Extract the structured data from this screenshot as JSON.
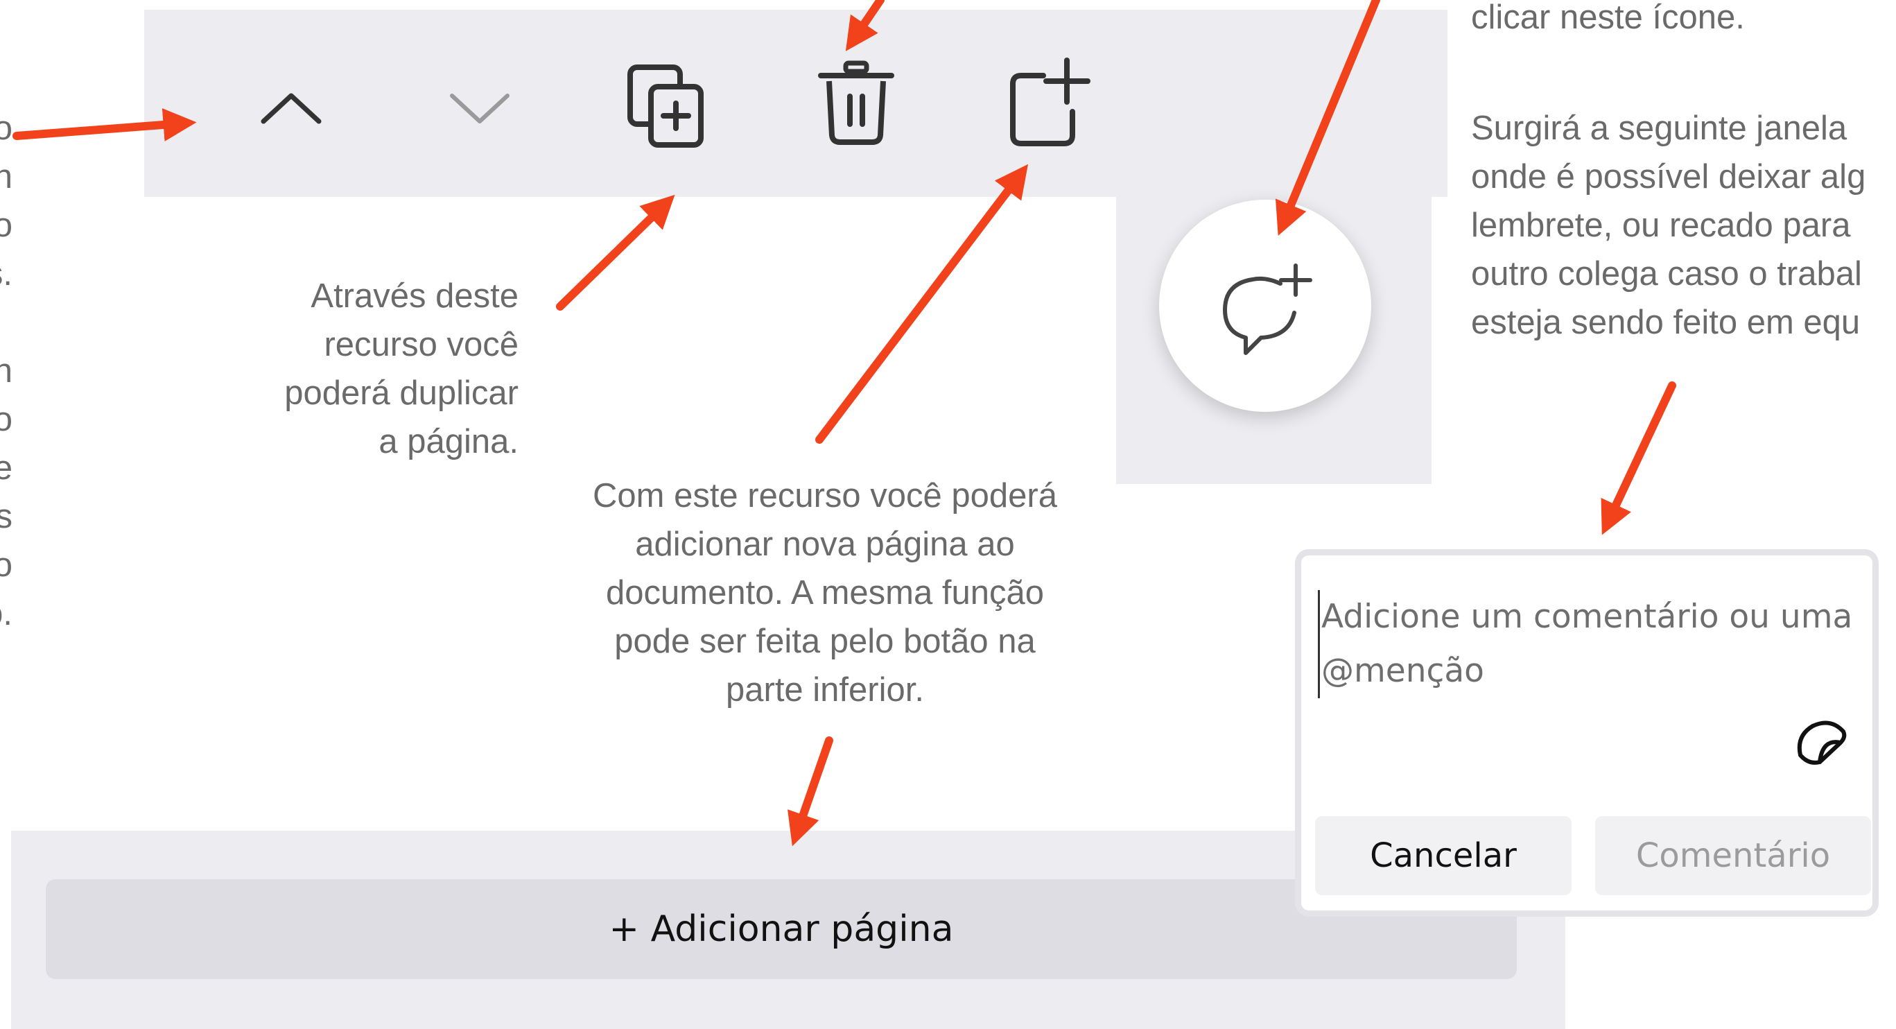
{
  "toolbar": {
    "move_up_icon": "chevron-up-icon",
    "move_down_icon": "chevron-down-icon",
    "duplicate_icon": "duplicate-page-icon",
    "delete_icon": "trash-icon",
    "add_page_icon": "add-page-icon"
  },
  "comment_button": {
    "icon": "comment-add-icon"
  },
  "annotations": {
    "duplicate": [
      "Através deste",
      "recurso você",
      "poderá duplicar",
      "a página."
    ],
    "add_page": [
      "Com este recurso você poderá",
      "adicionar nova página ao",
      "documento. A mesma função",
      "pode ser feita pelo botão na",
      "parte inferior."
    ],
    "comment_top": "clicar neste ícone.",
    "comment": [
      "Surgirá a seguinte janela",
      "onde é possível deixar alg",
      "lembrete, ou recado para",
      "outro colega caso o trabal",
      "esteja sendo feito em equ"
    ],
    "left_edge": [
      "o",
      "n",
      "o",
      "s.",
      "",
      "n",
      "o",
      "e",
      "s",
      "o",
      "o."
    ]
  },
  "comment_box": {
    "placeholder_line1": "Adicione um comentário ou uma",
    "placeholder_line2": "@menção",
    "sticker_icon": "sticker-icon",
    "cancel_label": "Cancelar",
    "submit_label": "Comentário"
  },
  "bottom": {
    "add_page_label": "+ Adicionar página"
  },
  "colors": {
    "arrow": "#f2421b",
    "panel": "#edecf0",
    "text": "#6a6a6a"
  }
}
